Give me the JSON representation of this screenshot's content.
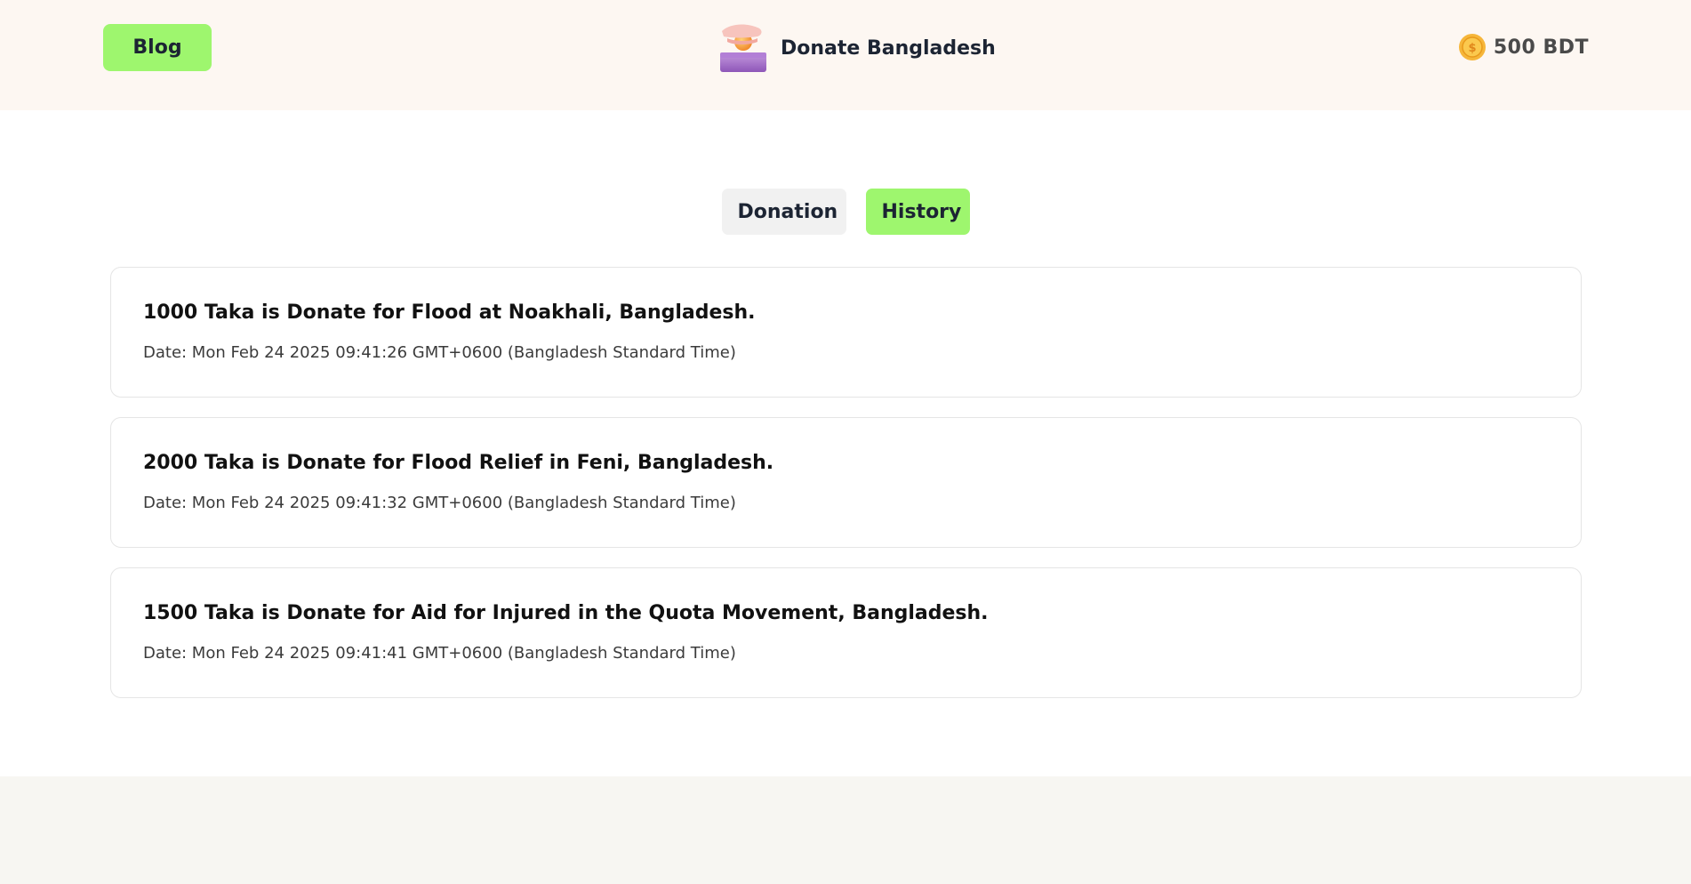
{
  "header": {
    "blog_label": "Blog",
    "brand_name": "Donate Bangladesh",
    "logo_icon": "donation-hand-coin-icon",
    "balance": "500 BDT",
    "balance_icon": "gold-coin-icon"
  },
  "tabs": [
    {
      "label": "Donation",
      "active": false
    },
    {
      "label": "History",
      "active": true
    }
  ],
  "history": [
    {
      "title": "1000 Taka is Donate for Flood at Noakhali, Bangladesh.",
      "date": "Date: Mon Feb 24 2025 09:41:26 GMT+0600 (Bangladesh Standard Time)"
    },
    {
      "title": "2000 Taka is Donate for Flood Relief in Feni, Bangladesh.",
      "date": "Date: Mon Feb 24 2025 09:41:32 GMT+0600 (Bangladesh Standard Time)"
    },
    {
      "title": "1500 Taka is Donate for Aid for Injured in the Quota Movement, Bangladesh.",
      "date": "Date: Mon Feb 24 2025 09:41:41 GMT+0600 (Bangladesh Standard Time)"
    }
  ],
  "colors": {
    "accent": "#9ef66e",
    "header_bg": "#fdf7f2",
    "inactive_tab": "#f1f1f1"
  }
}
